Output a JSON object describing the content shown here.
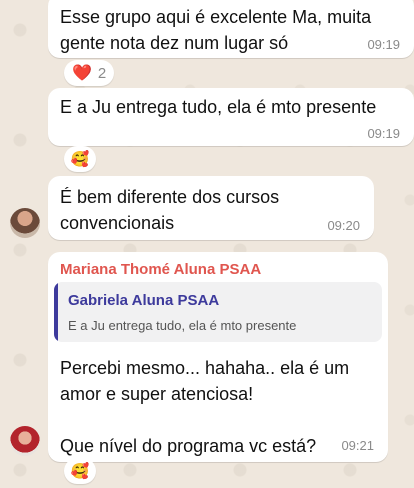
{
  "messages": [
    {
      "text": "Esse grupo aqui é excelente Ma, muita\ngente nota dez num lugar só",
      "time": "09:19",
      "reaction": {
        "emoji": "❤️",
        "count": "2"
      }
    },
    {
      "text": "E a Ju entrega tudo, ela é mto presente",
      "time": "09:19",
      "reaction": {
        "emoji": "🥰"
      }
    },
    {
      "text": "É bem diferente dos cursos\nconvencionais",
      "time": "09:20"
    },
    {
      "sender": "Mariana Thomé Aluna PSAA",
      "quote": {
        "author": "Gabriela Aluna PSAA",
        "text": "E a Ju entrega tudo, ela é mto presente"
      },
      "text": "Percebi mesmo... hahaha.. ela é um\namor e super atenciosa!\n\nQue nível do programa vc está?",
      "time": "09:21",
      "reaction": {
        "emoji": "🥰"
      }
    }
  ],
  "colors": {
    "sender_name": "#e0564f",
    "quote_author": "#3d3a9c",
    "quote_bar": "#3d3a9c",
    "heart": "#e0283c"
  }
}
